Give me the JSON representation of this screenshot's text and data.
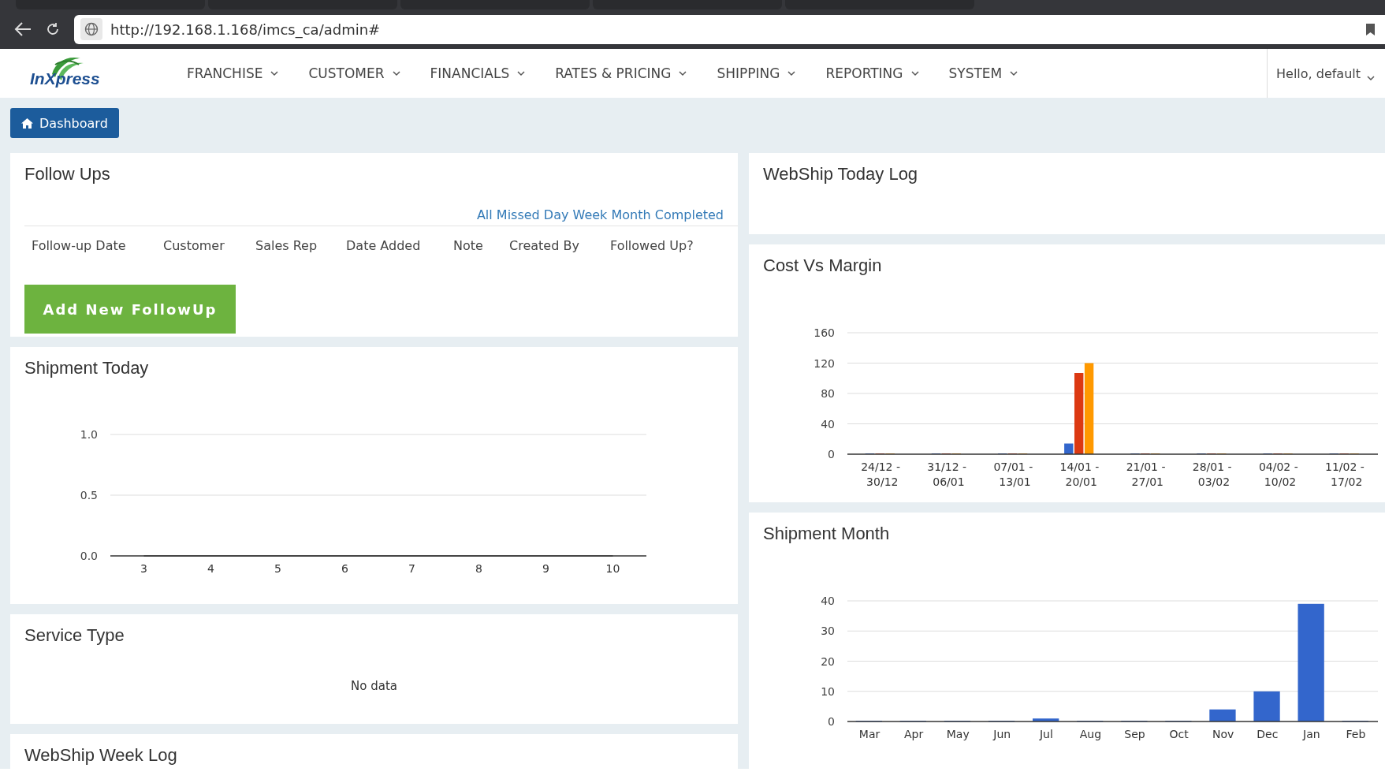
{
  "browser": {
    "url": "http://192.168.1.168/imcs_ca/admin#"
  },
  "header": {
    "logo_text": "InXpress",
    "menu": [
      {
        "label": "FRANCHISE"
      },
      {
        "label": "CUSTOMER"
      },
      {
        "label": "FINANCIALS"
      },
      {
        "label": "RATES & PRICING"
      },
      {
        "label": "SHIPPING"
      },
      {
        "label": "REPORTING"
      },
      {
        "label": "SYSTEM"
      }
    ],
    "user_menu": "Hello, default"
  },
  "breadcrumb": {
    "label": "Dashboard"
  },
  "left_panels": [
    {
      "kind": "followups",
      "title": "Follow Ups",
      "filters": [
        "All",
        "Missed",
        "Day",
        "Week",
        "Month",
        "Completed"
      ],
      "columns": [
        "Follow-up Date",
        "Customer",
        "Sales Rep",
        "Date Added",
        "Note",
        "Created By",
        "Followed Up?"
      ],
      "button": "Add New FollowUp"
    },
    {
      "kind": "chart",
      "title": "Shipment Today",
      "chart_data": {
        "type": "line",
        "categories": [
          "3",
          "4",
          "5",
          "6",
          "7",
          "8",
          "9",
          "10"
        ],
        "values": [
          0,
          0,
          0,
          0,
          0,
          0,
          0,
          0
        ],
        "grid": true,
        "ylim": [
          0,
          1
        ],
        "yticks": [
          {
            "value": 0,
            "label": "0.0"
          },
          {
            "value": 0.5,
            "label": "0.5"
          },
          {
            "value": 1,
            "label": "1.0"
          }
        ]
      }
    },
    {
      "kind": "message",
      "title": "Service Type",
      "message": "No data"
    },
    {
      "kind": "empty",
      "title": "WebShip Week Log"
    }
  ],
  "right_panels": [
    {
      "kind": "empty",
      "title": "WebShip Today Log"
    },
    {
      "kind": "chart",
      "title": "Cost Vs Margin",
      "chart_data": {
        "type": "bar",
        "categories": [
          "24/12 - 30/12",
          "31/12 - 06/01",
          "07/01 - 13/01",
          "14/01 - 20/01",
          "21/01 - 27/01",
          "28/01 - 03/02",
          "04/02 - 10/02",
          "11/02 - 17/02"
        ],
        "series": [
          {
            "color": "#3366cc",
            "values": [
              0,
              0,
              0,
              14,
              0,
              0,
              0,
              0
            ]
          },
          {
            "color": "#dc3912",
            "values": [
              0,
              0,
              0,
              107,
              0,
              0,
              0,
              0
            ]
          },
          {
            "color": "#ff9900",
            "values": [
              0,
              0,
              0,
              120,
              0,
              0,
              0,
              0
            ]
          }
        ],
        "grid": true,
        "ylim": [
          0,
          160
        ],
        "yticks": [
          0,
          40,
          80,
          120,
          160
        ]
      }
    },
    {
      "kind": "chart",
      "title": "Shipment Month",
      "chart_data": {
        "type": "bar",
        "categories": [
          "Mar",
          "Apr",
          "May",
          "Jun",
          "Jul",
          "Aug",
          "Sep",
          "Oct",
          "Nov",
          "Dec",
          "Jan",
          "Feb"
        ],
        "series": [
          {
            "color": "#3366cc",
            "values": [
              0,
              0,
              0,
              0,
              1,
              0,
              0,
              0,
              4,
              10,
              39,
              0
            ]
          }
        ],
        "grid": true,
        "ylim": [
          0,
          40
        ],
        "yticks": [
          0,
          10,
          20,
          30,
          40
        ]
      }
    }
  ]
}
